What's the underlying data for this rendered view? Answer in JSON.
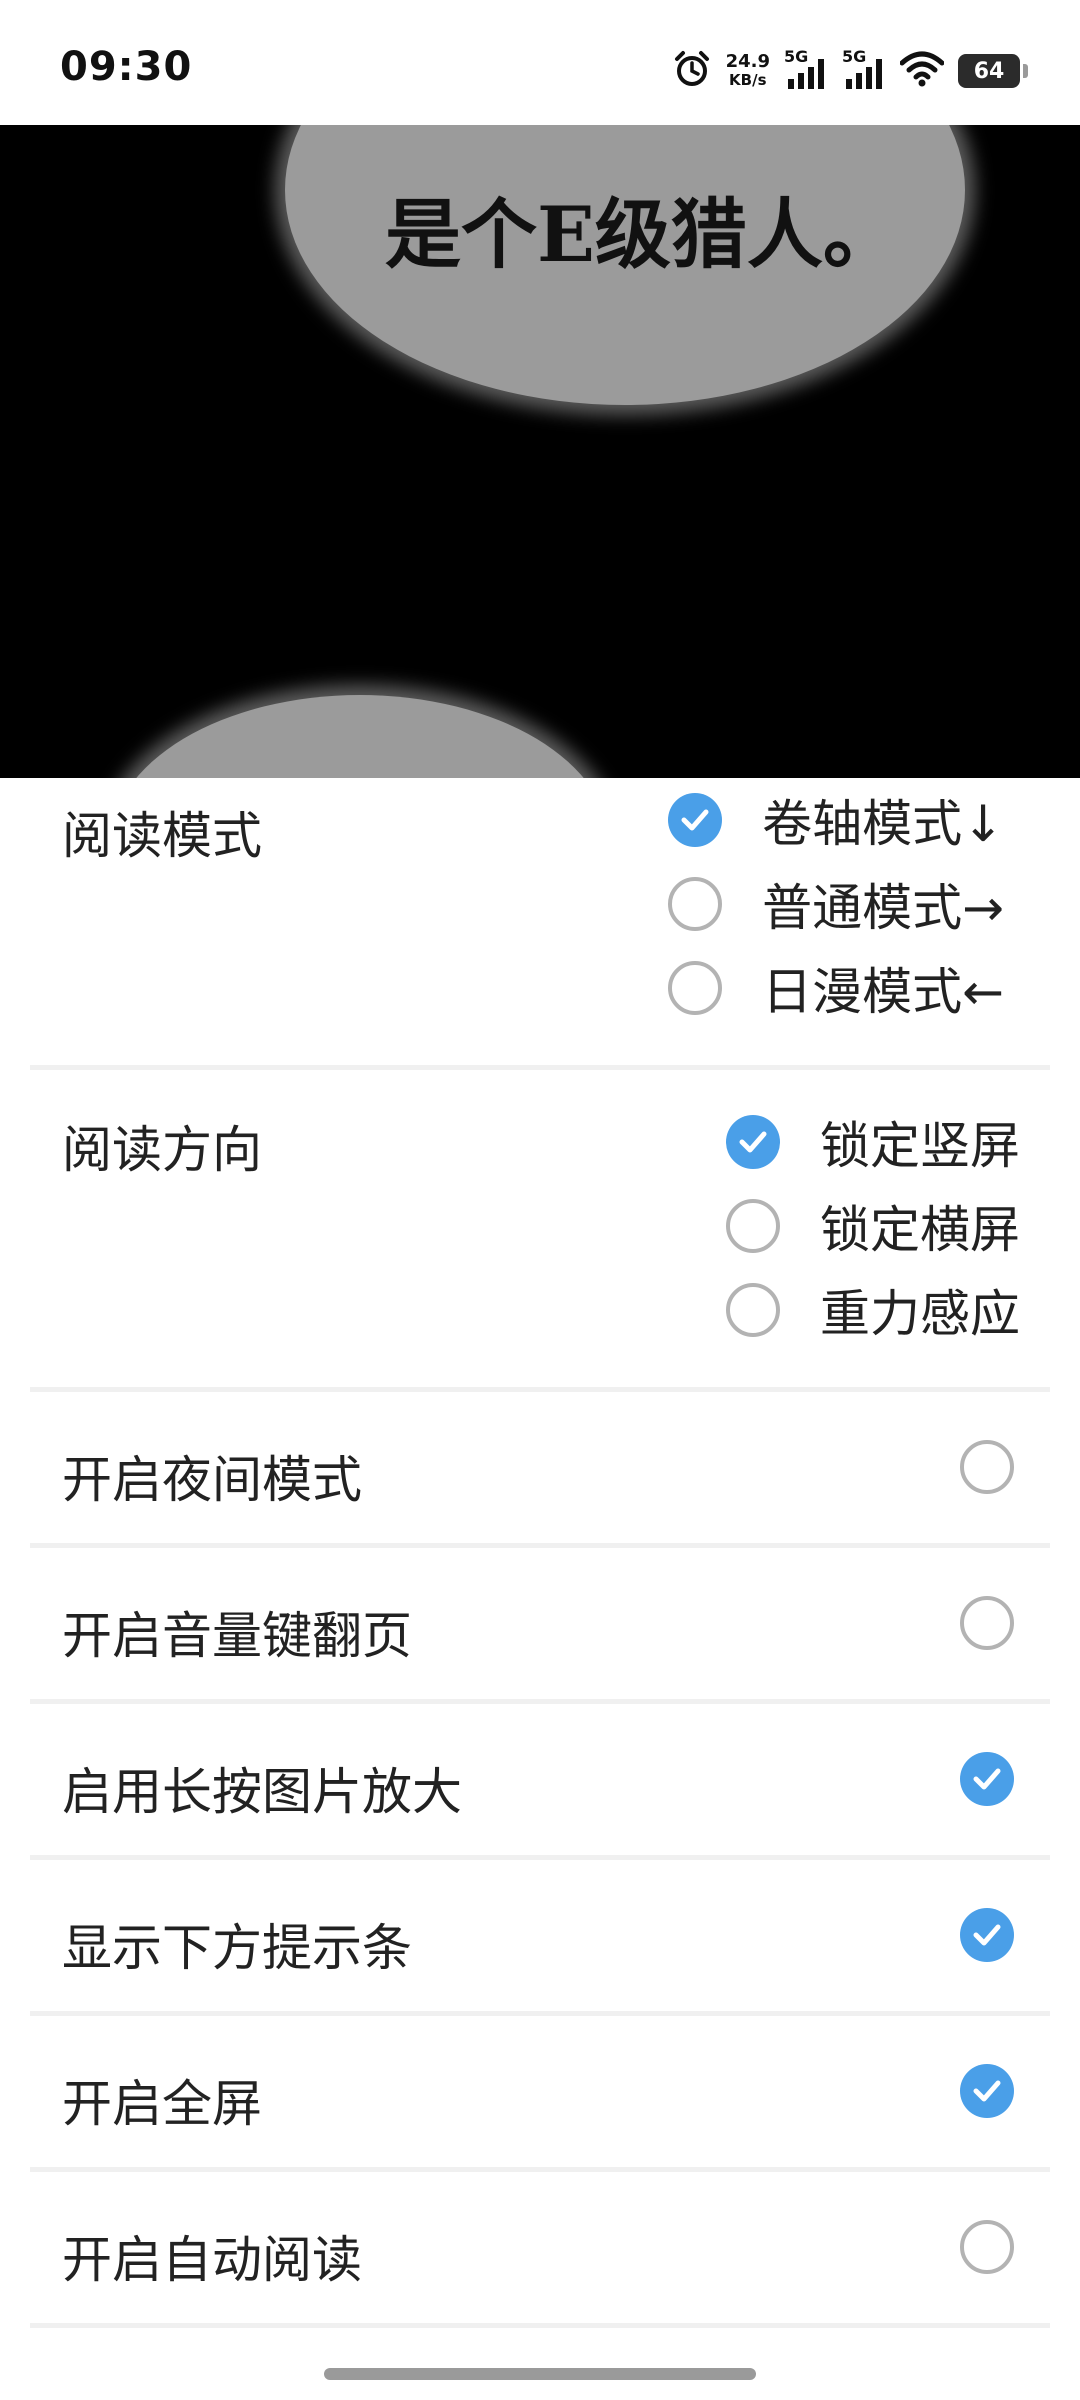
{
  "status_bar": {
    "time": "09:30",
    "net_speed_value": "24.9",
    "net_speed_unit": "KB/s",
    "sim1": "5G",
    "sim2": "5G",
    "battery": "64"
  },
  "comic": {
    "bubble_text": "是个E级猎人。"
  },
  "reading_mode": {
    "label": "阅读模式",
    "options": [
      {
        "label": "卷轴模式↓",
        "selected": true
      },
      {
        "label": "普通模式→",
        "selected": false
      },
      {
        "label": "日漫模式←",
        "selected": false
      }
    ]
  },
  "reading_direction": {
    "label": "阅读方向",
    "options": [
      {
        "label": "锁定竖屏",
        "selected": true
      },
      {
        "label": "锁定横屏",
        "selected": false
      },
      {
        "label": "重力感应",
        "selected": false
      }
    ]
  },
  "toggles": [
    {
      "label": "开启夜间模式",
      "checked": false
    },
    {
      "label": "开启音量键翻页",
      "checked": false
    },
    {
      "label": "启用长按图片放大",
      "checked": true
    },
    {
      "label": "显示下方提示条",
      "checked": true
    },
    {
      "label": "开启全屏",
      "checked": true
    },
    {
      "label": "开启自动阅读",
      "checked": false
    }
  ],
  "colors": {
    "accent": "#4a9fe8",
    "radio_off_border": "#b3b3b3",
    "divider": "#f0f0f0"
  }
}
